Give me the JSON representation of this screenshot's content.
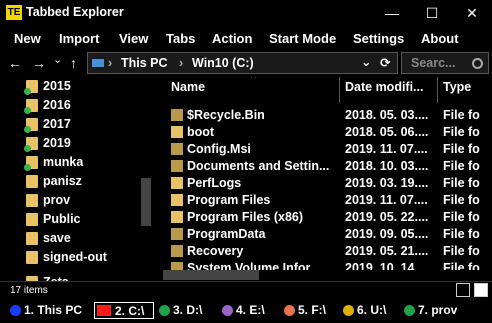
{
  "window": {
    "app_icon_text": "TE",
    "title": "Tabbed Explorer",
    "minimize": "—",
    "maximize": "☐",
    "close": "✕"
  },
  "menu": [
    "New",
    "Import",
    "View",
    "Tabs",
    "Action",
    "Start Mode",
    "Settings",
    "About"
  ],
  "nav": {
    "back": "←",
    "forward": "→",
    "dropdown": "⌄",
    "up": "↑"
  },
  "address": {
    "root_chevron": "›",
    "segments": [
      "This PC",
      "Win10 (C:)"
    ],
    "dropdown": "⌄",
    "refresh": "⟳"
  },
  "search": {
    "placeholder": "Searc..."
  },
  "tree": [
    {
      "label": "2015",
      "green": true
    },
    {
      "label": "2016",
      "green": true
    },
    {
      "label": "2017",
      "green": true
    },
    {
      "label": "2019",
      "green": true
    },
    {
      "label": "munka",
      "green": true
    },
    {
      "label": "panisz",
      "green": false
    },
    {
      "label": "prov",
      "green": false
    },
    {
      "label": "Public",
      "green": false
    },
    {
      "label": "save",
      "green": false
    },
    {
      "label": "signed-out",
      "green": false
    },
    {
      "label": "Zeta",
      "green": false
    }
  ],
  "file_list": {
    "columns": [
      "Name",
      "Date modifi...",
      "Type"
    ],
    "rows": [
      {
        "name": "$Recycle.Bin",
        "date": "2018. 05. 03....",
        "type": "File fo",
        "dim": true
      },
      {
        "name": "boot",
        "date": "2018. 05. 06....",
        "type": "File fo",
        "dim": false
      },
      {
        "name": "Config.Msi",
        "date": "2019. 11. 07....",
        "type": "File fo",
        "dim": true
      },
      {
        "name": "Documents and Settin...",
        "date": "2018. 10. 03....",
        "type": "File fo",
        "dim": true
      },
      {
        "name": "PerfLogs",
        "date": "2019. 03. 19....",
        "type": "File fo",
        "dim": false
      },
      {
        "name": "Program Files",
        "date": "2019. 11. 07....",
        "type": "File fo",
        "dim": false
      },
      {
        "name": "Program Files (x86)",
        "date": "2019. 05. 22....",
        "type": "File fo",
        "dim": false
      },
      {
        "name": "ProgramData",
        "date": "2019. 09. 05....",
        "type": "File fo",
        "dim": true
      },
      {
        "name": "Recovery",
        "date": "2019. 05. 21....",
        "type": "File fo",
        "dim": true
      },
      {
        "name": "System Volume Infor...",
        "date": "2019. 10. 14....",
        "type": "File fo",
        "dim": true
      }
    ]
  },
  "status": {
    "items": "17 items"
  },
  "drives": [
    {
      "label": "1. This PC",
      "color": "#1a3cff",
      "selected": false
    },
    {
      "label": "2. C:\\",
      "color": "#ff1a1a",
      "selected": true
    },
    {
      "label": "3. D:\\",
      "color": "#1fa34a",
      "selected": false
    },
    {
      "label": "4. E:\\",
      "color": "#9966cc",
      "selected": false
    },
    {
      "label": "5. F:\\",
      "color": "#e8734a",
      "selected": false
    },
    {
      "label": "6. U:\\",
      "color": "#e0b000",
      "selected": false
    },
    {
      "label": "7. prov",
      "color": "#1fa34a",
      "selected": false
    }
  ]
}
